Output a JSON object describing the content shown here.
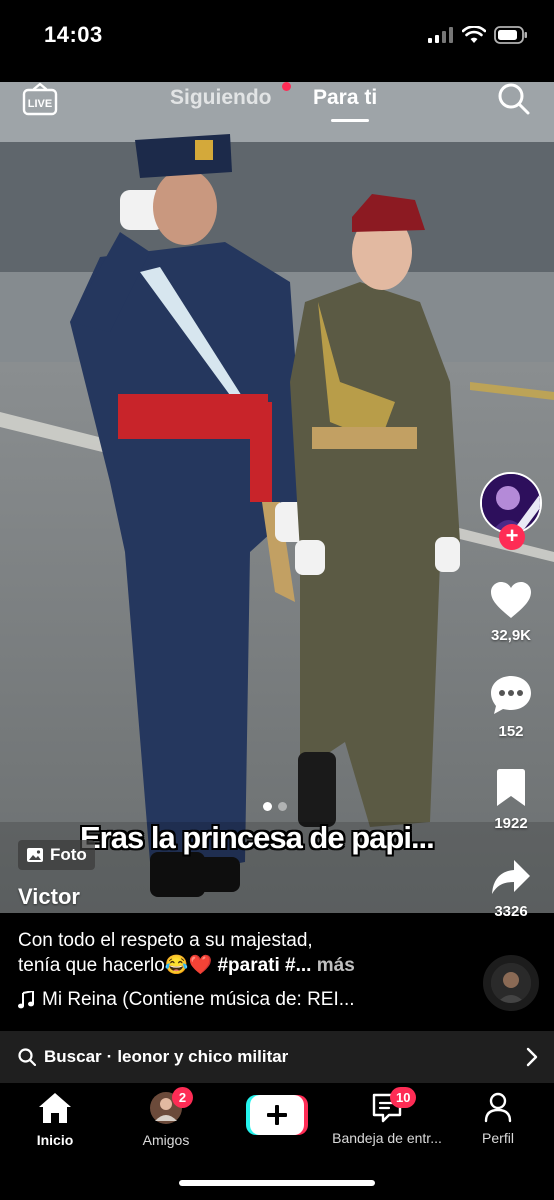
{
  "status": {
    "time": "14:03"
  },
  "top_nav": {
    "live_label": "LIVE",
    "tabs": [
      {
        "label": "Siguiendo",
        "active": false
      },
      {
        "label": "Para ti",
        "active": true
      }
    ]
  },
  "post": {
    "overlay_caption": "Eras la princesa de papi...",
    "carousel": {
      "total": 2,
      "current": 1
    },
    "type_badge": "Foto",
    "author": "Victor",
    "description_line1": "Con todo el respeto a su majestad,",
    "description_line2_text": "tenía que hacerlo",
    "description_emojis": "😂❤️",
    "description_hashtags": "#parati #...",
    "description_more": "más",
    "music": "Mi Reina (Contiene música de: REI..."
  },
  "actions": {
    "likes": "32,9K",
    "comments": "152",
    "saves": "1922",
    "shares": "3326"
  },
  "search_bar": {
    "prefix": "Buscar",
    "separator": "·",
    "query": "leonor y chico militar"
  },
  "bottom_nav": {
    "items": [
      {
        "label": "Inicio",
        "active": true
      },
      {
        "label": "Amigos",
        "badge": "2"
      },
      {
        "label": "",
        "type": "create"
      },
      {
        "label": "Bandeja de entr...",
        "badge": "10"
      },
      {
        "label": "Perfil"
      }
    ]
  },
  "colors": {
    "accent": "#fe2c55",
    "create_cyan": "#25f4ee",
    "background": "#000000"
  }
}
